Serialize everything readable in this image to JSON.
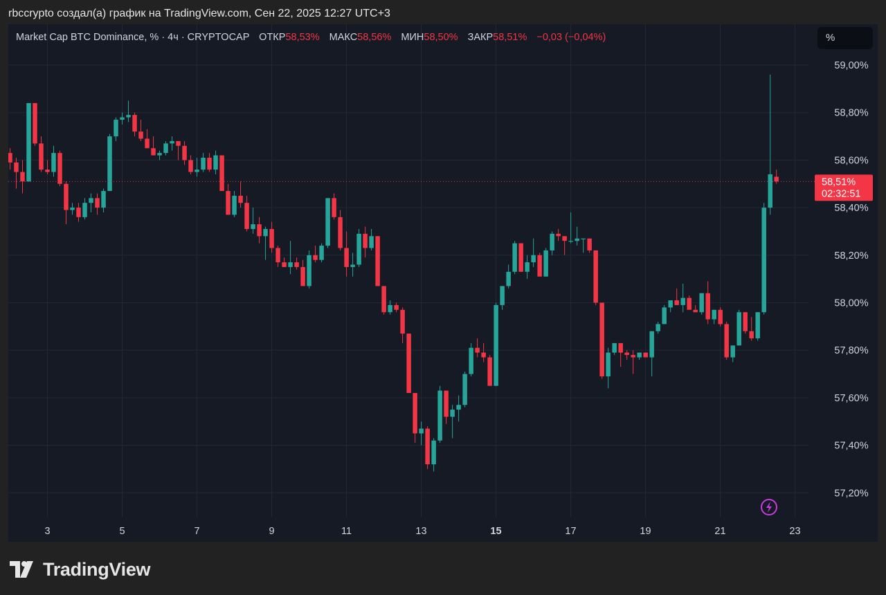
{
  "header": {
    "caption": "rbccrypto создал(а) график на TradingView.com, Сен 22, 2025 12:27 UTC+3"
  },
  "legend": {
    "symbol": "Market Cap BTC Dominance, % · 4ч · CRYPTOCAP",
    "open_label": "ОТКР",
    "open_value": "58,53%",
    "high_label": "МАКС",
    "high_value": "58,56%",
    "low_label": "МИН",
    "low_value": "58,50%",
    "close_label": "ЗАКР",
    "close_value": "58,51%",
    "change": "−0,03 (−0,04%)"
  },
  "scale_button": "%",
  "price_badge": {
    "price": "58,51%",
    "countdown": "02:32:51"
  },
  "footer": {
    "brand": "TradingView"
  },
  "colors": {
    "up": "#26a69a",
    "down": "#f23645",
    "grid": "#232837",
    "text": "#d1d4dc"
  },
  "chart_data": {
    "type": "candlestick",
    "y_unit": "%",
    "ylim": [
      57.07,
      59.1
    ],
    "y_ticks": [
      57.2,
      57.4,
      57.6,
      57.8,
      58.0,
      58.2,
      58.4,
      58.6,
      58.8,
      59.0
    ],
    "y_tick_labels": [
      "57,20%",
      "57,40%",
      "57,60%",
      "57,80%",
      "58,00%",
      "58,20%",
      "58,40%",
      "58,60%",
      "58,80%",
      "59,00%"
    ],
    "x_ticks": [
      3,
      5,
      7,
      9,
      11,
      13,
      15,
      17,
      19,
      21,
      23
    ],
    "x_tick_labels": [
      "3",
      "5",
      "7",
      "9",
      "11",
      "13",
      "15",
      "17",
      "19",
      "21",
      "23"
    ],
    "x_bold_label": "15",
    "x_start": 2.0,
    "x_step": 0.1667,
    "last_price": 58.51,
    "grid": true,
    "ohlc": [
      [
        58.63,
        58.65,
        58.56,
        58.59
      ],
      [
        58.59,
        58.61,
        58.48,
        58.55
      ],
      [
        58.55,
        58.6,
        58.46,
        58.51
      ],
      [
        58.51,
        58.84,
        58.51,
        58.84
      ],
      [
        58.84,
        58.84,
        58.66,
        58.67
      ],
      [
        58.67,
        58.7,
        58.55,
        58.56
      ],
      [
        58.56,
        58.6,
        58.54,
        58.55
      ],
      [
        58.55,
        58.66,
        58.53,
        58.63
      ],
      [
        58.63,
        58.64,
        58.49,
        58.5
      ],
      [
        58.5,
        58.51,
        58.33,
        58.39
      ],
      [
        58.39,
        58.42,
        58.37,
        58.4
      ],
      [
        58.4,
        58.42,
        58.34,
        58.36
      ],
      [
        58.36,
        58.44,
        58.35,
        58.42
      ],
      [
        58.42,
        58.46,
        58.38,
        58.44
      ],
      [
        58.44,
        58.46,
        58.37,
        58.4
      ],
      [
        58.4,
        58.48,
        58.38,
        58.47
      ],
      [
        58.47,
        58.71,
        58.47,
        58.7
      ],
      [
        58.7,
        58.78,
        58.68,
        58.77
      ],
      [
        58.77,
        58.8,
        58.75,
        58.78
      ],
      [
        58.78,
        58.85,
        58.76,
        58.79
      ],
      [
        58.79,
        58.8,
        58.7,
        58.72
      ],
      [
        58.72,
        58.77,
        58.68,
        58.69
      ],
      [
        58.69,
        58.73,
        58.65,
        58.65
      ],
      [
        58.65,
        58.7,
        58.62,
        58.62
      ],
      [
        58.62,
        58.64,
        58.6,
        58.63
      ],
      [
        58.63,
        58.68,
        58.62,
        58.67
      ],
      [
        58.67,
        58.7,
        58.64,
        58.68
      ],
      [
        58.68,
        58.68,
        58.6,
        58.66
      ],
      [
        58.66,
        58.68,
        58.58,
        58.6
      ],
      [
        58.6,
        58.62,
        58.54,
        58.55
      ],
      [
        58.55,
        58.61,
        58.53,
        58.56
      ],
      [
        58.56,
        58.63,
        58.55,
        58.61
      ],
      [
        58.61,
        58.63,
        58.55,
        58.56
      ],
      [
        58.56,
        58.64,
        58.54,
        58.62
      ],
      [
        58.62,
        58.62,
        58.47,
        58.47
      ],
      [
        58.47,
        58.5,
        58.37,
        58.37
      ],
      [
        58.37,
        58.47,
        58.36,
        58.45
      ],
      [
        58.45,
        58.51,
        58.4,
        58.42
      ],
      [
        58.42,
        58.45,
        58.3,
        58.31
      ],
      [
        58.31,
        58.4,
        58.29,
        58.33
      ],
      [
        58.33,
        58.36,
        58.25,
        58.28
      ],
      [
        58.28,
        58.32,
        58.18,
        58.31
      ],
      [
        58.31,
        58.34,
        58.21,
        58.23
      ],
      [
        58.23,
        58.24,
        58.15,
        58.17
      ],
      [
        58.17,
        58.19,
        58.15,
        58.15
      ],
      [
        58.15,
        58.26,
        58.12,
        58.17
      ],
      [
        58.17,
        58.19,
        58.14,
        58.15
      ],
      [
        58.15,
        58.18,
        58.07,
        58.07
      ],
      [
        58.07,
        58.22,
        58.06,
        58.2
      ],
      [
        58.2,
        58.24,
        58.17,
        58.18
      ],
      [
        58.18,
        58.25,
        58.17,
        58.24
      ],
      [
        58.24,
        58.44,
        58.23,
        58.44
      ],
      [
        58.44,
        58.46,
        58.35,
        58.36
      ],
      [
        58.36,
        58.39,
        58.22,
        58.23
      ],
      [
        58.23,
        58.3,
        58.11,
        58.15
      ],
      [
        58.15,
        58.21,
        58.11,
        58.16
      ],
      [
        58.16,
        58.31,
        58.15,
        58.29
      ],
      [
        58.29,
        58.32,
        58.19,
        58.23
      ],
      [
        58.23,
        58.31,
        58.22,
        58.28
      ],
      [
        58.28,
        58.28,
        58.07,
        58.07
      ],
      [
        58.07,
        58.07,
        57.95,
        57.96
      ],
      [
        57.96,
        58.01,
        57.95,
        57.99
      ],
      [
        57.99,
        58.0,
        57.96,
        57.97
      ],
      [
        57.97,
        57.98,
        57.83,
        57.87
      ],
      [
        57.87,
        57.87,
        57.62,
        57.62
      ],
      [
        57.62,
        57.62,
        57.41,
        57.45
      ],
      [
        57.45,
        57.5,
        57.4,
        57.47
      ],
      [
        57.47,
        57.48,
        57.3,
        57.32
      ],
      [
        57.32,
        57.43,
        57.29,
        57.42
      ],
      [
        57.42,
        57.65,
        57.41,
        57.63
      ],
      [
        57.63,
        57.63,
        57.49,
        57.52
      ],
      [
        57.52,
        57.57,
        57.43,
        57.55
      ],
      [
        57.55,
        57.61,
        57.5,
        57.57
      ],
      [
        57.57,
        57.71,
        57.56,
        57.7
      ],
      [
        57.7,
        57.83,
        57.69,
        57.81
      ],
      [
        57.81,
        57.85,
        57.77,
        57.79
      ],
      [
        57.79,
        57.83,
        57.75,
        57.77
      ],
      [
        57.77,
        57.78,
        57.65,
        57.65
      ],
      [
        57.65,
        58.0,
        57.65,
        57.99
      ],
      [
        57.99,
        58.07,
        57.97,
        58.07
      ],
      [
        58.07,
        58.16,
        58.06,
        58.13
      ],
      [
        58.13,
        58.26,
        58.12,
        58.25
      ],
      [
        58.25,
        58.25,
        58.13,
        58.13
      ],
      [
        58.13,
        58.2,
        58.1,
        58.17
      ],
      [
        58.17,
        58.27,
        58.15,
        58.2
      ],
      [
        58.2,
        58.21,
        58.11,
        58.11
      ],
      [
        58.11,
        58.23,
        58.11,
        58.22
      ],
      [
        58.22,
        58.3,
        58.2,
        58.29
      ],
      [
        58.29,
        58.31,
        58.26,
        58.28
      ],
      [
        58.28,
        58.28,
        58.2,
        58.26
      ],
      [
        58.26,
        58.38,
        58.25,
        58.26
      ],
      [
        58.26,
        58.32,
        58.24,
        58.27
      ],
      [
        58.27,
        58.27,
        58.21,
        58.27
      ],
      [
        58.27,
        58.27,
        58.21,
        58.22
      ],
      [
        58.22,
        58.22,
        57.99,
        58.0
      ],
      [
        58.0,
        58.0,
        57.68,
        57.69
      ],
      [
        57.69,
        57.81,
        57.64,
        57.79
      ],
      [
        57.79,
        57.83,
        57.78,
        57.83
      ],
      [
        57.83,
        57.83,
        57.73,
        57.79
      ],
      [
        57.79,
        57.8,
        57.76,
        57.78
      ],
      [
        57.78,
        57.8,
        57.7,
        57.77
      ],
      [
        57.77,
        57.79,
        57.76,
        57.79
      ],
      [
        57.79,
        57.79,
        57.77,
        57.77
      ],
      [
        57.77,
        57.88,
        57.69,
        57.88
      ],
      [
        57.88,
        57.92,
        57.87,
        57.91
      ],
      [
        57.91,
        57.99,
        57.91,
        57.98
      ],
      [
        57.98,
        58.01,
        57.96,
        58.01
      ],
      [
        58.01,
        58.06,
        57.99,
        57.99
      ],
      [
        57.99,
        58.08,
        57.96,
        58.02
      ],
      [
        58.02,
        58.03,
        57.98,
        57.97
      ],
      [
        57.97,
        57.99,
        57.96,
        57.96
      ],
      [
        57.96,
        58.04,
        57.95,
        58.04
      ],
      [
        58.04,
        58.09,
        57.91,
        57.93
      ],
      [
        57.93,
        57.97,
        57.91,
        57.97
      ],
      [
        57.97,
        57.98,
        57.9,
        57.91
      ],
      [
        57.91,
        57.92,
        57.76,
        57.77
      ],
      [
        57.77,
        57.82,
        57.75,
        57.82
      ],
      [
        57.82,
        57.97,
        57.82,
        57.96
      ],
      [
        57.96,
        57.96,
        57.87,
        57.88
      ],
      [
        57.88,
        57.94,
        57.84,
        57.85
      ],
      [
        57.85,
        57.96,
        57.84,
        57.96
      ],
      [
        57.96,
        58.42,
        57.95,
        58.4
      ],
      [
        58.4,
        58.96,
        58.37,
        58.54
      ],
      [
        58.53,
        58.56,
        58.5,
        58.51
      ]
    ]
  }
}
